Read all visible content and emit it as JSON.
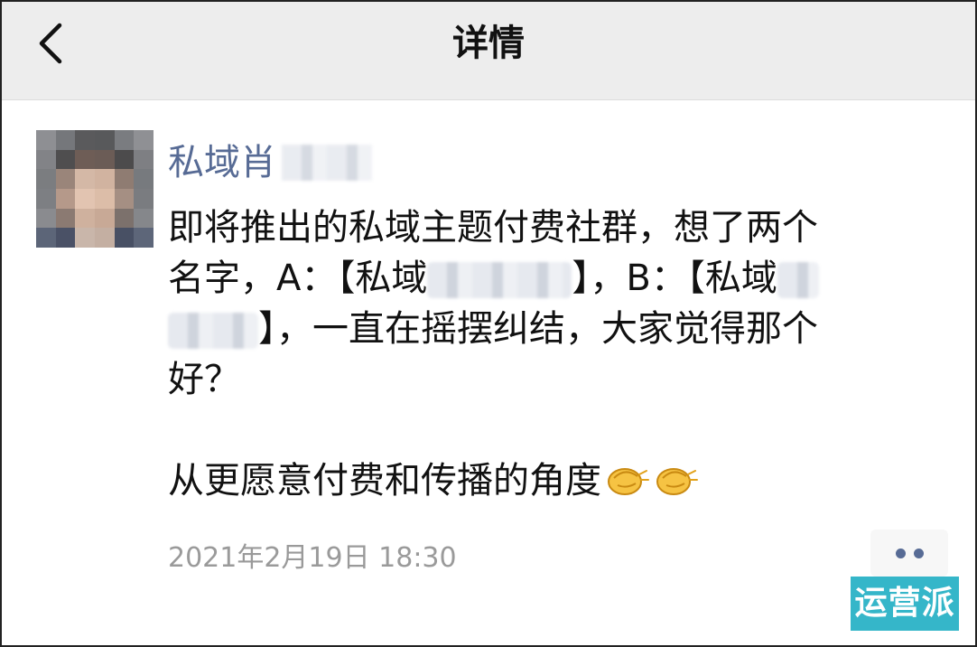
{
  "header": {
    "title": "详情"
  },
  "post": {
    "author_name": "私域肖",
    "lines": {
      "l1": "即将推出的私域主题付费社群，想了两个",
      "l2_a": "名字，A：【私域",
      "l2_b": "】，B：【私域",
      "l3": "】，一直在摇摆纠结，大家觉得那个",
      "l4": "好？",
      "l5": "从更愿意付费和传播的角度"
    },
    "emoji": [
      "clapping-hands-emoji",
      "clapping-hands-emoji"
    ],
    "timestamp": "2021年2月19日 18:30"
  },
  "watermark": {
    "text": "运营派"
  },
  "colors": {
    "header_bg": "#ededed",
    "author_link": "#576b95",
    "timestamp": "#9a9a9a",
    "watermark_bg": "#35b6c9"
  },
  "icons": {
    "back": "chevron-left-icon",
    "more": "more-dots-icon"
  }
}
